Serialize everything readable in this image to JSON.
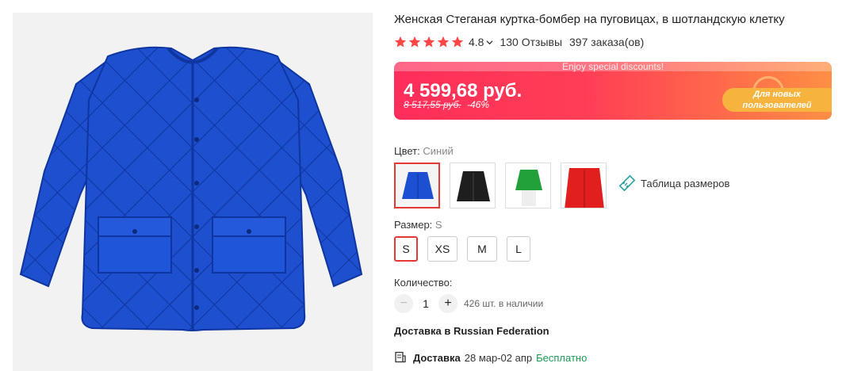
{
  "product": {
    "title": "Женская Стеганая куртка-бомбер на пуговицах, в шотландскую клетку",
    "image_icon": "blue-quilted-jacket-image",
    "rating": {
      "stars": 5,
      "value": "4.8",
      "reviews": "130 Отзывы",
      "orders": "397 заказа(ов)"
    },
    "price_banner": {
      "promo": "Enjoy special discounts!",
      "price": "4 599,68 руб.",
      "old_price": "8 517,55 руб.",
      "discount": "-46%",
      "badge": "Для новых пользователей"
    },
    "color": {
      "label": "Цвет:",
      "value": "Синий",
      "swatches": [
        {
          "name": "blue",
          "color": "#1c4fd1"
        },
        {
          "name": "black",
          "color": "#1e1e1e"
        },
        {
          "name": "green",
          "color": "#22a03a"
        },
        {
          "name": "red",
          "color": "#e11f1f"
        }
      ],
      "size_table": "Таблица размеров"
    },
    "size": {
      "label": "Размер:",
      "value": "S",
      "options": [
        "S",
        "XS",
        "M",
        "L"
      ]
    },
    "quantity": {
      "label": "Количество:",
      "value": "1",
      "minus": "−",
      "plus": "+",
      "stock": "426 шт. в наличии"
    },
    "delivery": {
      "title": "Доставка в Russian Federation",
      "label": "Доставка",
      "dates": "28 мар-02 апр",
      "free": "Бесплатно"
    }
  },
  "colors": {
    "accent": "#e53935",
    "star": "#ff4747",
    "free": "#1a9a55",
    "ruler": "#2aa3a3"
  }
}
